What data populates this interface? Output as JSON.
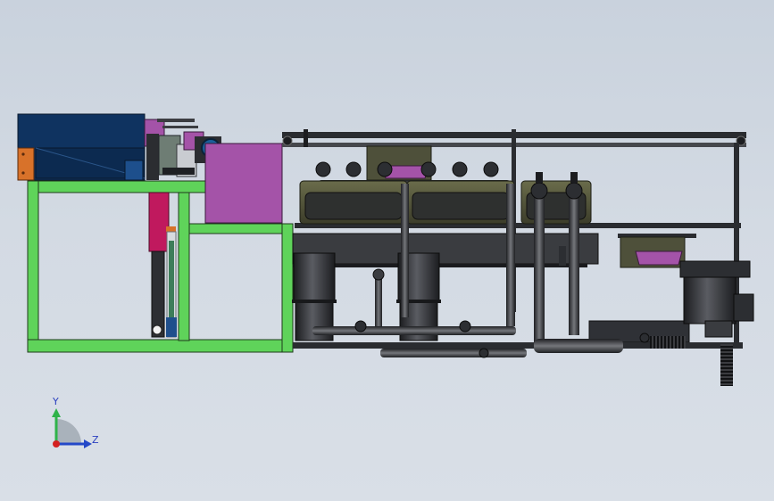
{
  "viewport": {
    "background_top": "#c9d2dd",
    "background_bottom": "#d9dfe7"
  },
  "triad": {
    "y_label": "Y",
    "z_label": "Z",
    "y_color": "#2fb34a",
    "z_color": "#2448c8",
    "x_color": "#d42020"
  },
  "colors": {
    "frame_green": "#5fd35a",
    "navy_hopper": "#0f3360",
    "magenta_panel": "#a453a8",
    "crimson_part": "#c0195e",
    "orange_bracket": "#d8722a",
    "dark_steel": "#2f3136",
    "olive_tank": "#57593c"
  }
}
